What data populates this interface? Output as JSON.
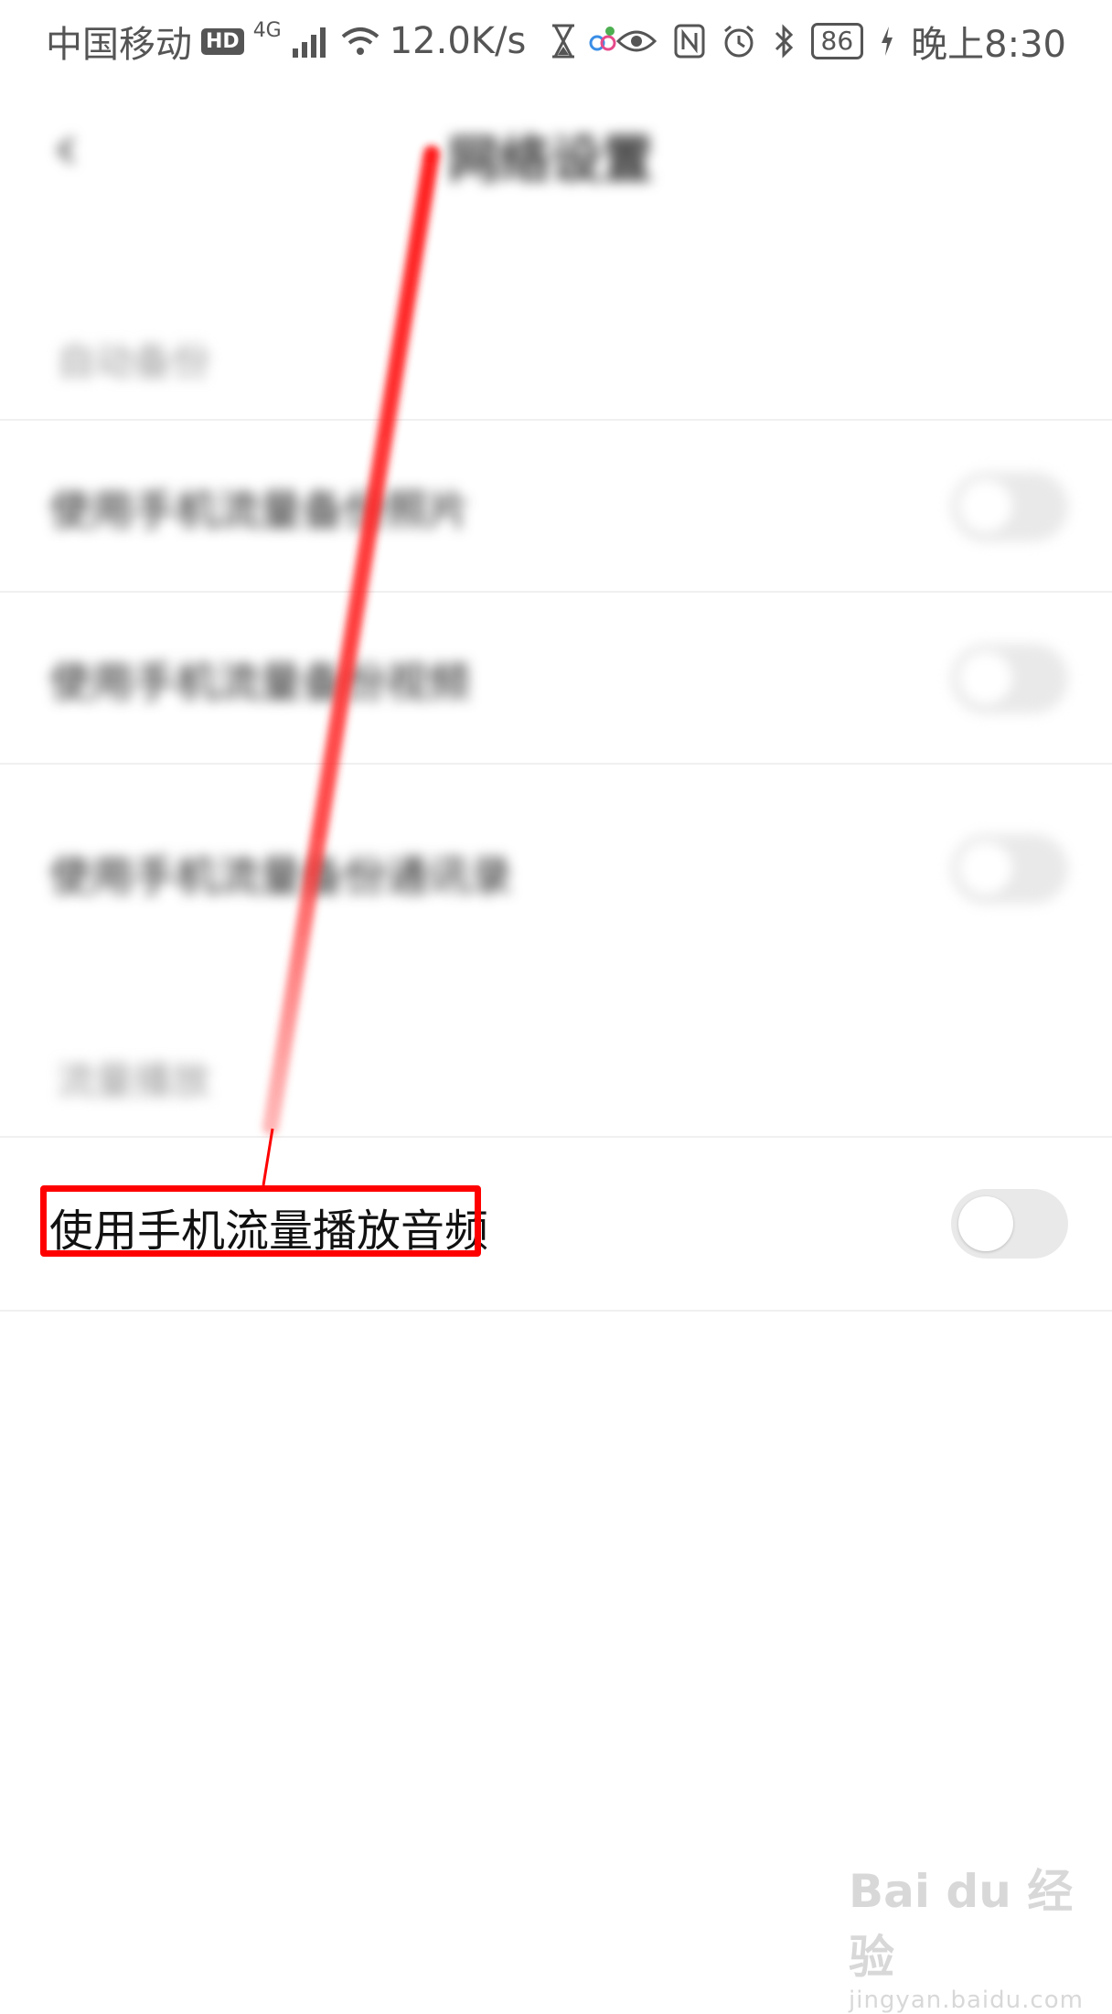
{
  "status_bar": {
    "carrier": "中国移动",
    "hd": "HD",
    "network": "4G",
    "speed": "12.0K/s",
    "battery": "86",
    "time": "晚上8:30"
  },
  "header": {
    "back_icon": "chevron-left-icon",
    "title": "网络设置"
  },
  "sections": [
    {
      "header": "自动备份",
      "items": [
        {
          "label": "使用手机流量备份照片",
          "enabled": false
        },
        {
          "label": "使用手机流量备份视频",
          "enabled": false
        },
        {
          "label": "使用手机流量备份通讯录",
          "enabled": false
        }
      ]
    },
    {
      "header": "流量播放",
      "items": [
        {
          "label": "使用手机流量播放音频",
          "enabled": false
        }
      ]
    }
  ],
  "annotation": {
    "color": "#ff0000"
  },
  "watermark": {
    "brand": "Bai du 经验",
    "url": "jingyan.baidu.com"
  }
}
